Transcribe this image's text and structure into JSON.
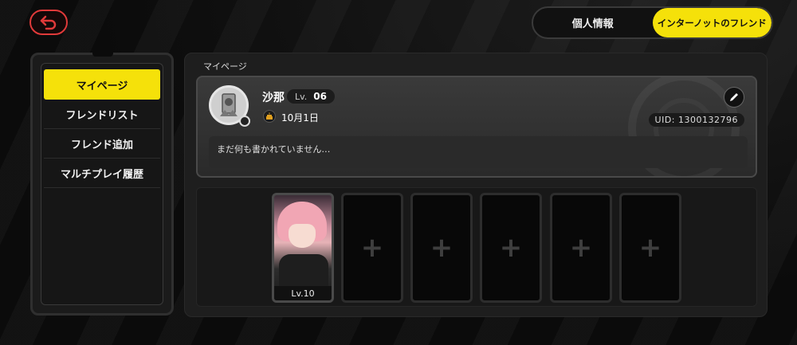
{
  "top_tabs": {
    "profile": "個人情報",
    "internot": "インターノットのフレンド"
  },
  "sidebar": {
    "items": [
      {
        "label": "マイページ"
      },
      {
        "label": "フレンドリスト"
      },
      {
        "label": "フレンド追加"
      },
      {
        "label": "マルチプレイ履歴"
      }
    ]
  },
  "main": {
    "title": "マイページ",
    "profile": {
      "name": "沙那",
      "level_prefix": "Lv.",
      "level": "06",
      "birthday": "10月1日",
      "uid": "UID: 1300132796",
      "bio": "まだ何も書かれていません…"
    },
    "agents": [
      {
        "filled": true,
        "level": "Lv.10"
      },
      {
        "filled": false,
        "plus": "+"
      },
      {
        "filled": false,
        "plus": "+"
      },
      {
        "filled": false,
        "plus": "+"
      },
      {
        "filled": false,
        "plus": "+"
      },
      {
        "filled": false,
        "plus": "+"
      }
    ]
  },
  "colors": {
    "accent": "#f5e10a",
    "back": "#e03a3a"
  },
  "icons": [
    "back-arrow-icon",
    "edit-pencil-icon",
    "cake-icon",
    "avatar-icon",
    "plus-icon"
  ]
}
